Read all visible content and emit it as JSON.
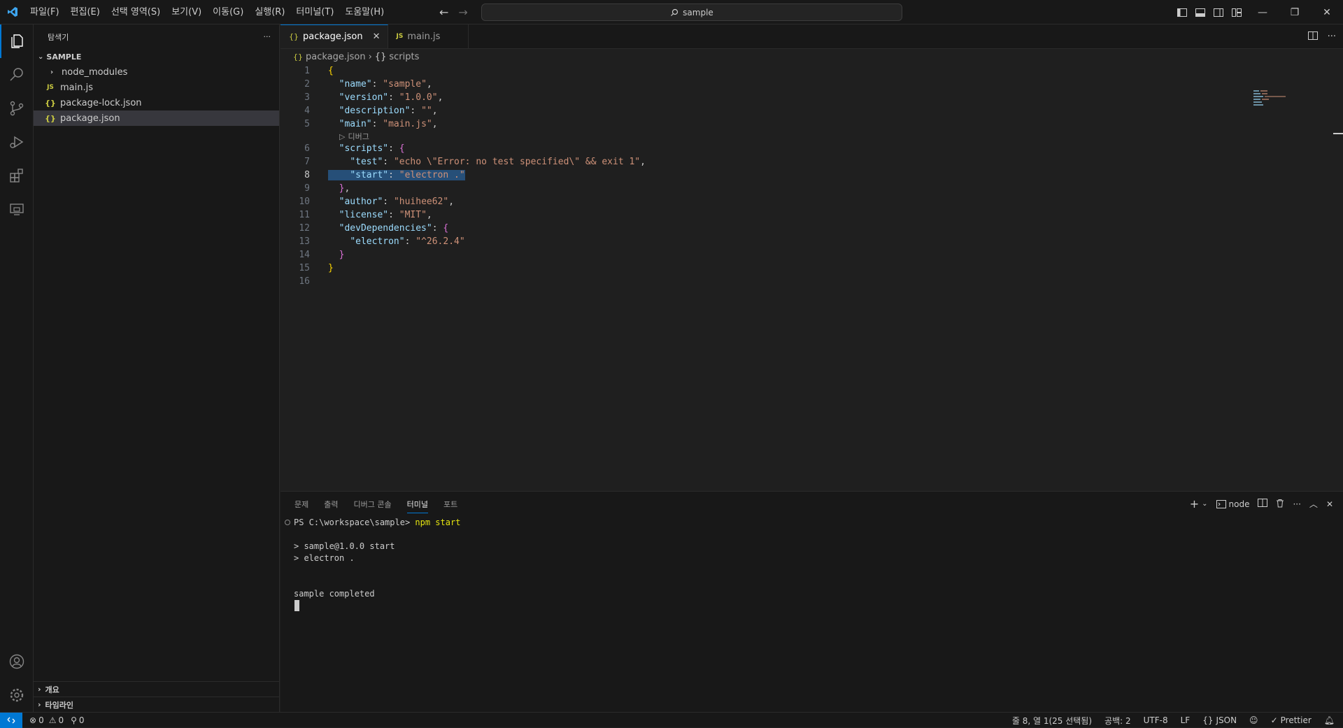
{
  "menu": [
    "파일(F)",
    "편집(E)",
    "선택 영역(S)",
    "보기(V)",
    "이동(G)",
    "실행(R)",
    "터미널(T)",
    "도움말(H)"
  ],
  "search": {
    "text": "sample"
  },
  "sidebar": {
    "title": "탐색기",
    "more": "···",
    "root": "SAMPLE",
    "items": [
      {
        "label": "node_modules",
        "icon": "chevron-right-icon"
      },
      {
        "label": "main.js",
        "icon": "JS"
      },
      {
        "label": "package-lock.json",
        "icon": "{}"
      },
      {
        "label": "package.json",
        "icon": "{}"
      }
    ],
    "outline": "개요",
    "timeline": "타임라인"
  },
  "tabs": [
    {
      "label": "package.json",
      "icon": "{}"
    },
    {
      "label": "main.js",
      "icon": "JS"
    }
  ],
  "breadcrumb": {
    "file": "package.json",
    "section": "scripts",
    "icon": "{}"
  },
  "code": {
    "lines": [
      "1",
      "2",
      "3",
      "4",
      "5",
      "6",
      "7",
      "8",
      "9",
      "10",
      "11",
      "12",
      "13",
      "14",
      "15",
      "16"
    ],
    "codelens": "디버그",
    "name_key": "\"name\"",
    "name_val": "\"sample\"",
    "version_key": "\"version\"",
    "version_val": "\"1.0.0\"",
    "desc_key": "\"description\"",
    "desc_val": "\"\"",
    "main_key": "\"main\"",
    "main_val": "\"main.js\"",
    "scripts_key": "\"scripts\"",
    "test_key": "\"test\"",
    "test_val": "\"echo \\\"Error: no test specified\\\" && exit 1\"",
    "start_key": "\"start\"",
    "start_val": "\"electron .\"",
    "author_key": "\"author\"",
    "author_val": "\"huihee62\"",
    "license_key": "\"license\"",
    "license_val": "\"MIT\"",
    "devdeps_key": "\"devDependencies\"",
    "electron_key": "\"electron\"",
    "electron_val": "\"^26.2.4\""
  },
  "panel": {
    "tabs": [
      "문제",
      "출력",
      "디버그 콘솔",
      "터미널",
      "포트"
    ],
    "shell": "node",
    "prompt": "PS C:\\workspace\\sample>",
    "command": "npm start",
    "out1": "> sample@1.0.0 start",
    "out2": "> electron .",
    "out3": "sample completed"
  },
  "status": {
    "errors": "0",
    "warnings": "0",
    "ports": "0",
    "position": "줄 8, 열 1(25 선택됨)",
    "spaces": "공백: 2",
    "encoding": "UTF-8",
    "eol": "LF",
    "language": "JSON",
    "language_icon": "{}",
    "prettier": "Prettier"
  },
  "colors": {
    "accent": "#0078d4",
    "string": "#ce9178",
    "key": "#9cdcfe",
    "bracket1": "#ffd700",
    "bracket2": "#da70d6"
  }
}
